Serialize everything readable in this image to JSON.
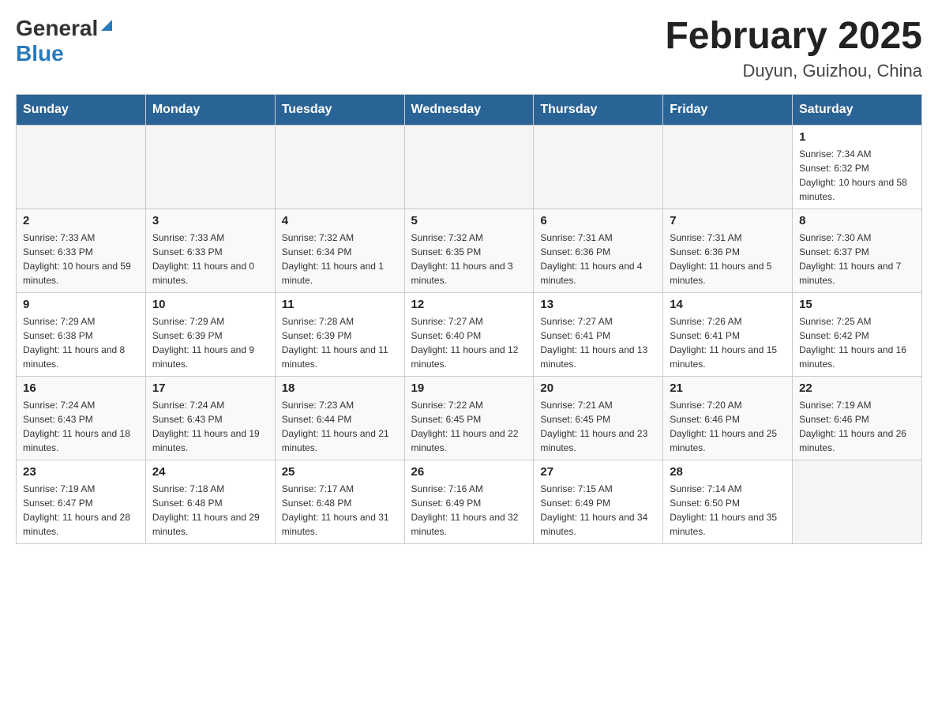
{
  "header": {
    "logo_general": "General",
    "logo_blue": "Blue",
    "month_title": "February 2025",
    "location": "Duyun, Guizhou, China"
  },
  "weekdays": [
    "Sunday",
    "Monday",
    "Tuesday",
    "Wednesday",
    "Thursday",
    "Friday",
    "Saturday"
  ],
  "weeks": [
    [
      {
        "day": "",
        "sunrise": "",
        "sunset": "",
        "daylight": ""
      },
      {
        "day": "",
        "sunrise": "",
        "sunset": "",
        "daylight": ""
      },
      {
        "day": "",
        "sunrise": "",
        "sunset": "",
        "daylight": ""
      },
      {
        "day": "",
        "sunrise": "",
        "sunset": "",
        "daylight": ""
      },
      {
        "day": "",
        "sunrise": "",
        "sunset": "",
        "daylight": ""
      },
      {
        "day": "",
        "sunrise": "",
        "sunset": "",
        "daylight": ""
      },
      {
        "day": "1",
        "sunrise": "Sunrise: 7:34 AM",
        "sunset": "Sunset: 6:32 PM",
        "daylight": "Daylight: 10 hours and 58 minutes."
      }
    ],
    [
      {
        "day": "2",
        "sunrise": "Sunrise: 7:33 AM",
        "sunset": "Sunset: 6:33 PM",
        "daylight": "Daylight: 10 hours and 59 minutes."
      },
      {
        "day": "3",
        "sunrise": "Sunrise: 7:33 AM",
        "sunset": "Sunset: 6:33 PM",
        "daylight": "Daylight: 11 hours and 0 minutes."
      },
      {
        "day": "4",
        "sunrise": "Sunrise: 7:32 AM",
        "sunset": "Sunset: 6:34 PM",
        "daylight": "Daylight: 11 hours and 1 minute."
      },
      {
        "day": "5",
        "sunrise": "Sunrise: 7:32 AM",
        "sunset": "Sunset: 6:35 PM",
        "daylight": "Daylight: 11 hours and 3 minutes."
      },
      {
        "day": "6",
        "sunrise": "Sunrise: 7:31 AM",
        "sunset": "Sunset: 6:36 PM",
        "daylight": "Daylight: 11 hours and 4 minutes."
      },
      {
        "day": "7",
        "sunrise": "Sunrise: 7:31 AM",
        "sunset": "Sunset: 6:36 PM",
        "daylight": "Daylight: 11 hours and 5 minutes."
      },
      {
        "day": "8",
        "sunrise": "Sunrise: 7:30 AM",
        "sunset": "Sunset: 6:37 PM",
        "daylight": "Daylight: 11 hours and 7 minutes."
      }
    ],
    [
      {
        "day": "9",
        "sunrise": "Sunrise: 7:29 AM",
        "sunset": "Sunset: 6:38 PM",
        "daylight": "Daylight: 11 hours and 8 minutes."
      },
      {
        "day": "10",
        "sunrise": "Sunrise: 7:29 AM",
        "sunset": "Sunset: 6:39 PM",
        "daylight": "Daylight: 11 hours and 9 minutes."
      },
      {
        "day": "11",
        "sunrise": "Sunrise: 7:28 AM",
        "sunset": "Sunset: 6:39 PM",
        "daylight": "Daylight: 11 hours and 11 minutes."
      },
      {
        "day": "12",
        "sunrise": "Sunrise: 7:27 AM",
        "sunset": "Sunset: 6:40 PM",
        "daylight": "Daylight: 11 hours and 12 minutes."
      },
      {
        "day": "13",
        "sunrise": "Sunrise: 7:27 AM",
        "sunset": "Sunset: 6:41 PM",
        "daylight": "Daylight: 11 hours and 13 minutes."
      },
      {
        "day": "14",
        "sunrise": "Sunrise: 7:26 AM",
        "sunset": "Sunset: 6:41 PM",
        "daylight": "Daylight: 11 hours and 15 minutes."
      },
      {
        "day": "15",
        "sunrise": "Sunrise: 7:25 AM",
        "sunset": "Sunset: 6:42 PM",
        "daylight": "Daylight: 11 hours and 16 minutes."
      }
    ],
    [
      {
        "day": "16",
        "sunrise": "Sunrise: 7:24 AM",
        "sunset": "Sunset: 6:43 PM",
        "daylight": "Daylight: 11 hours and 18 minutes."
      },
      {
        "day": "17",
        "sunrise": "Sunrise: 7:24 AM",
        "sunset": "Sunset: 6:43 PM",
        "daylight": "Daylight: 11 hours and 19 minutes."
      },
      {
        "day": "18",
        "sunrise": "Sunrise: 7:23 AM",
        "sunset": "Sunset: 6:44 PM",
        "daylight": "Daylight: 11 hours and 21 minutes."
      },
      {
        "day": "19",
        "sunrise": "Sunrise: 7:22 AM",
        "sunset": "Sunset: 6:45 PM",
        "daylight": "Daylight: 11 hours and 22 minutes."
      },
      {
        "day": "20",
        "sunrise": "Sunrise: 7:21 AM",
        "sunset": "Sunset: 6:45 PM",
        "daylight": "Daylight: 11 hours and 23 minutes."
      },
      {
        "day": "21",
        "sunrise": "Sunrise: 7:20 AM",
        "sunset": "Sunset: 6:46 PM",
        "daylight": "Daylight: 11 hours and 25 minutes."
      },
      {
        "day": "22",
        "sunrise": "Sunrise: 7:19 AM",
        "sunset": "Sunset: 6:46 PM",
        "daylight": "Daylight: 11 hours and 26 minutes."
      }
    ],
    [
      {
        "day": "23",
        "sunrise": "Sunrise: 7:19 AM",
        "sunset": "Sunset: 6:47 PM",
        "daylight": "Daylight: 11 hours and 28 minutes."
      },
      {
        "day": "24",
        "sunrise": "Sunrise: 7:18 AM",
        "sunset": "Sunset: 6:48 PM",
        "daylight": "Daylight: 11 hours and 29 minutes."
      },
      {
        "day": "25",
        "sunrise": "Sunrise: 7:17 AM",
        "sunset": "Sunset: 6:48 PM",
        "daylight": "Daylight: 11 hours and 31 minutes."
      },
      {
        "day": "26",
        "sunrise": "Sunrise: 7:16 AM",
        "sunset": "Sunset: 6:49 PM",
        "daylight": "Daylight: 11 hours and 32 minutes."
      },
      {
        "day": "27",
        "sunrise": "Sunrise: 7:15 AM",
        "sunset": "Sunset: 6:49 PM",
        "daylight": "Daylight: 11 hours and 34 minutes."
      },
      {
        "day": "28",
        "sunrise": "Sunrise: 7:14 AM",
        "sunset": "Sunset: 6:50 PM",
        "daylight": "Daylight: 11 hours and 35 minutes."
      },
      {
        "day": "",
        "sunrise": "",
        "sunset": "",
        "daylight": ""
      }
    ]
  ]
}
